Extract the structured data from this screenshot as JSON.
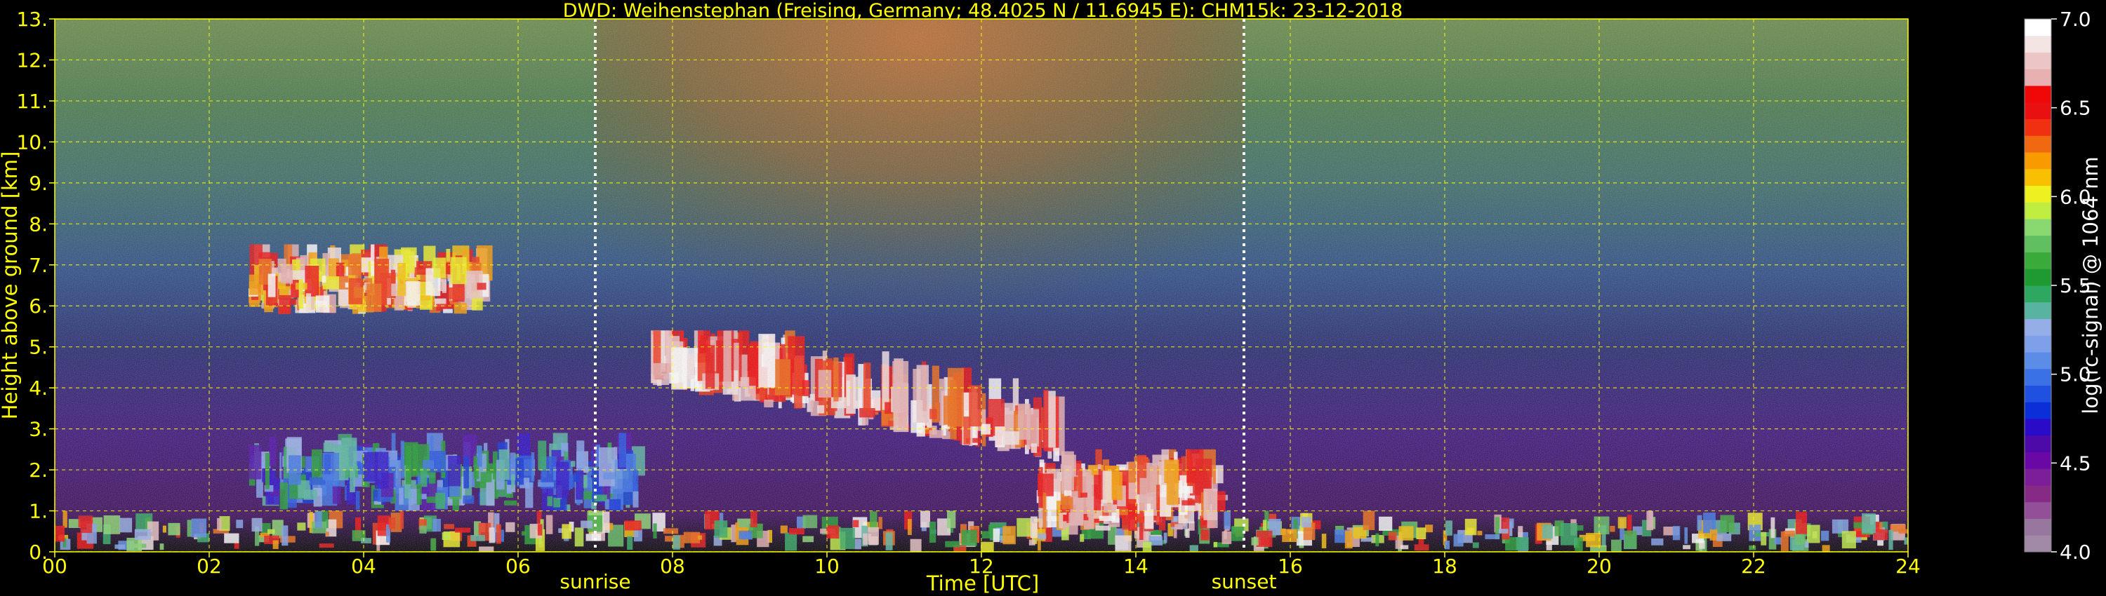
{
  "chart_data": {
    "type": "heatmap",
    "title": "DWD: Weihenstephan (Freising, Germany; 48.4025 N / 11.6945 E):    CHM15k: 23-12-2018",
    "xlabel": "Time [UTC]",
    "ylabel": "Height above ground [km]",
    "xlim": [
      0,
      24
    ],
    "ylim": [
      0,
      13
    ],
    "x_ticks": [
      "00",
      "02",
      "04",
      "06",
      "08",
      "10",
      "12",
      "14",
      "16",
      "18",
      "20",
      "22",
      "24"
    ],
    "y_ticks": [
      "0.",
      "1.",
      "2.",
      "3.",
      "4.",
      "5.",
      "6.",
      "7.",
      "8.",
      "9.",
      "10.",
      "11.",
      "12.",
      "13."
    ],
    "grid": true,
    "annotations": [
      {
        "label": "sunrise",
        "x": 7.0
      },
      {
        "label": "sunset",
        "x": 15.4
      }
    ],
    "colorbar": {
      "label": "log(rc-signal) @ 1064 nm",
      "range": [
        4.0,
        7.0
      ],
      "ticks": [
        "4.0",
        "4.5",
        "5.0",
        "5.5",
        "6.0",
        "6.5",
        "7.0"
      ],
      "colors": [
        "#a08aa8",
        "#98779f",
        "#934f98",
        "#862a86",
        "#7c1d9a",
        "#6a08a6",
        "#4e0aa8",
        "#2a0bc8",
        "#0a2ed8",
        "#2050e0",
        "#3a72e6",
        "#5a8ce8",
        "#7ea0ea",
        "#96aee8",
        "#58b4a0",
        "#2ea860",
        "#1e9a30",
        "#3aaa3a",
        "#60c060",
        "#8ad870",
        "#c0ee40",
        "#eef020",
        "#f8c000",
        "#f89a00",
        "#f06810",
        "#f03010",
        "#e81010",
        "#f00808",
        "#e8b0b0",
        "#ecc6c6",
        "#f4e4e4",
        "#ffffff"
      ]
    },
    "features": [
      {
        "kind": "boundary-layer-aerosol",
        "x": [
          0,
          24
        ],
        "height_km": [
          0,
          1.0
        ],
        "log_signal": [
          5.0,
          7.0
        ]
      },
      {
        "kind": "residual-layer",
        "x": [
          2.5,
          7.5
        ],
        "height_km": [
          1.0,
          2.9
        ],
        "log_signal": [
          4.6,
          5.6
        ]
      },
      {
        "kind": "cloud-layer",
        "x": [
          2.5,
          5.5
        ],
        "height_km": [
          5.8,
          7.5
        ],
        "log_signal": [
          6.0,
          7.0
        ]
      },
      {
        "kind": "cloud-layer",
        "x": [
          7.7,
          13.0
        ],
        "height_km": [
          2.2,
          5.4
        ],
        "log_signal": [
          6.3,
          7.0
        ]
      },
      {
        "kind": "low-cloud",
        "x": [
          12.7,
          15.0
        ],
        "height_km": [
          0.5,
          2.5
        ],
        "log_signal": [
          6.2,
          7.0
        ]
      },
      {
        "kind": "solar-background",
        "x": [
          7.0,
          15.4
        ],
        "height_km": [
          4.0,
          13.0
        ],
        "log_signal": [
          5.5,
          6.3
        ]
      }
    ]
  }
}
